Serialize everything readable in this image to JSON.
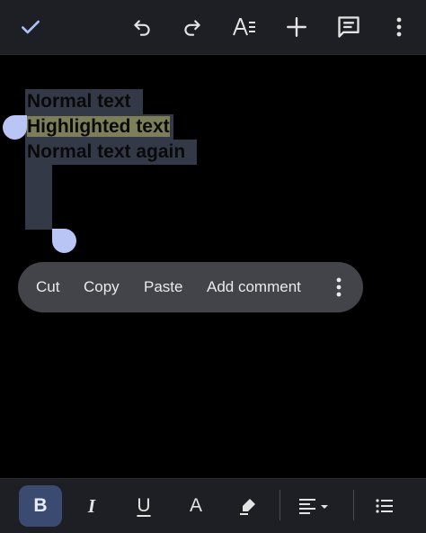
{
  "toolbar": {
    "icons": [
      "check-icon",
      "undo-icon",
      "redo-icon",
      "text-format-icon",
      "add-icon",
      "comment-icon",
      "more-vert-icon"
    ]
  },
  "document": {
    "lines": [
      "Normal text",
      "Highlighted text",
      "Normal text again"
    ],
    "highlight_color": "#7c7f58",
    "selection_color": "#333947"
  },
  "context_menu": {
    "items": [
      "Cut",
      "Copy",
      "Paste",
      "Add comment"
    ]
  },
  "format_bar": {
    "bold": "B",
    "italic": "I",
    "underline": "U",
    "text_color": "A",
    "bold_active": true
  }
}
